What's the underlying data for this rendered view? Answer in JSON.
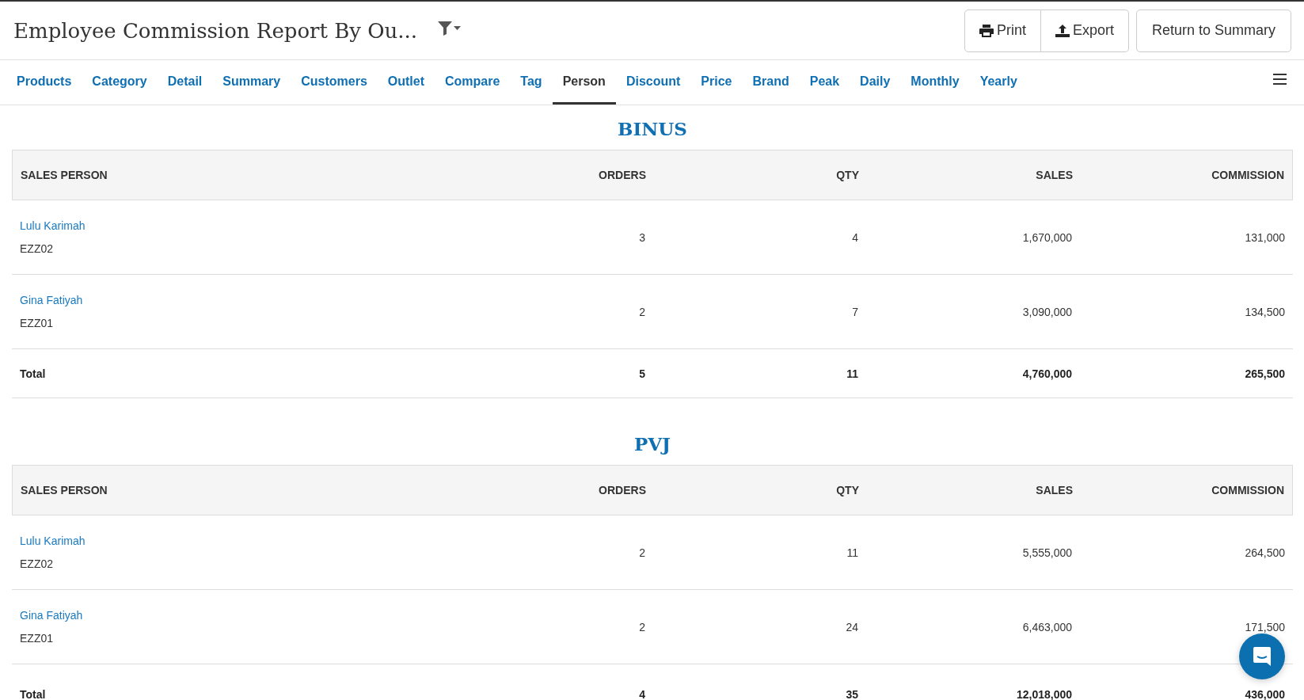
{
  "header": {
    "title": "Employee Commission Report By Ou...",
    "buttons": [
      {
        "kind": "print",
        "label": "Print"
      },
      {
        "kind": "export",
        "label": "Export"
      }
    ],
    "return_button": "Return to Summary"
  },
  "tabs": [
    {
      "label": "Products",
      "selected": false
    },
    {
      "label": "Category",
      "selected": false
    },
    {
      "label": "Detail",
      "selected": false
    },
    {
      "label": "Summary",
      "selected": false
    },
    {
      "label": "Customers",
      "selected": false
    },
    {
      "label": "Outlet",
      "selected": false
    },
    {
      "label": "Compare",
      "selected": false
    },
    {
      "label": "Tag",
      "selected": false
    },
    {
      "label": "Person",
      "selected": true
    },
    {
      "label": "Discount",
      "selected": false
    },
    {
      "label": "Price",
      "selected": false
    },
    {
      "label": "Brand",
      "selected": false
    },
    {
      "label": "Peak",
      "selected": false
    },
    {
      "label": "Daily",
      "selected": false
    },
    {
      "label": "Monthly",
      "selected": false
    },
    {
      "label": "Yearly",
      "selected": false
    }
  ],
  "sections": [
    {
      "title": "BINUS",
      "columns": [
        "SALES PERSON",
        "ORDERS",
        "QTY",
        "SALES",
        "COMMISSION"
      ],
      "rows": [
        {
          "name": "Lulu Karimah",
          "code": "EZZ02",
          "orders": "3",
          "qty": "4",
          "sales": "1,670,000",
          "commission": "131,000"
        },
        {
          "name": "Gina Fatiyah",
          "code": "EZZ01",
          "orders": "2",
          "qty": "7",
          "sales": "3,090,000",
          "commission": "134,500"
        }
      ],
      "total": {
        "label": "Total",
        "orders": "5",
        "qty": "11",
        "sales": "4,760,000",
        "commission": "265,500"
      }
    },
    {
      "title": "PVJ",
      "columns": [
        "SALES PERSON",
        "ORDERS",
        "QTY",
        "SALES",
        "COMMISSION"
      ],
      "rows": [
        {
          "name": "Lulu Karimah",
          "code": "EZZ02",
          "orders": "2",
          "qty": "11",
          "sales": "5,555,000",
          "commission": "264,500"
        },
        {
          "name": "Gina Fatiyah",
          "code": "EZZ01",
          "orders": "2",
          "qty": "24",
          "sales": "6,463,000",
          "commission": "171,500"
        }
      ],
      "total": {
        "label": "Total",
        "orders": "4",
        "qty": "35",
        "sales": "12,018,000",
        "commission": "436,000"
      }
    }
  ]
}
